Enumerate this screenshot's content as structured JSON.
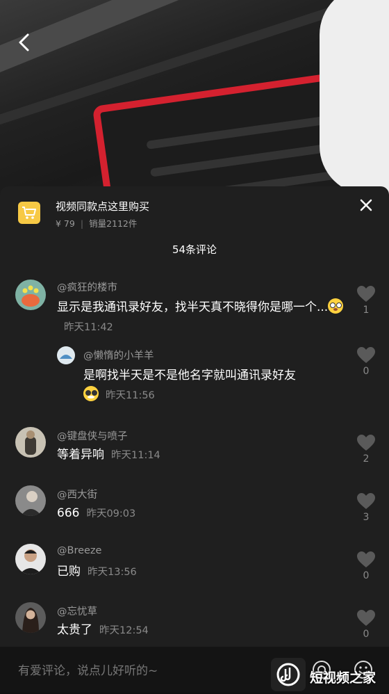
{
  "shop": {
    "title": "视频同款点这里购买",
    "price": "¥ 79",
    "sales": "销量2112件"
  },
  "comment_count": "54条评论",
  "comments": [
    {
      "author": "@疯狂的楼市",
      "text": "显示是我通讯录好友，找半天真不晓得你是哪一个...",
      "time": "昨天11:42",
      "likes": "1"
    },
    {
      "author": "@懒惰的小羊羊",
      "text": "是啊找半天是不是他名字就叫通讯录好友",
      "time": "昨天11:56",
      "likes": "0"
    },
    {
      "author": "@键盘侠与喷子",
      "text": "等着异响",
      "time": "昨天11:14",
      "likes": "2"
    },
    {
      "author": "@西大街",
      "text": "666",
      "time": "昨天09:03",
      "likes": "3"
    },
    {
      "author": "@Breeze",
      "text": "已购",
      "time": "昨天13:56",
      "likes": "0"
    },
    {
      "author": "@忘忧草",
      "text": "太贵了",
      "time": "昨天12:54",
      "likes": "0"
    }
  ],
  "input": {
    "placeholder": "有爱评论，说点儿好听的~"
  },
  "watermark": "短视频之家",
  "icons": {
    "back": "back-chevron-icon",
    "cart": "cart-icon",
    "close": "close-icon",
    "heart": "heart-icon",
    "at": "at-icon",
    "emoji": "emoji-icon"
  },
  "colors": {
    "cart_bg": "#f7c945",
    "accent_red": "#d4212f",
    "sheet_bg": "#1f1f1f"
  }
}
